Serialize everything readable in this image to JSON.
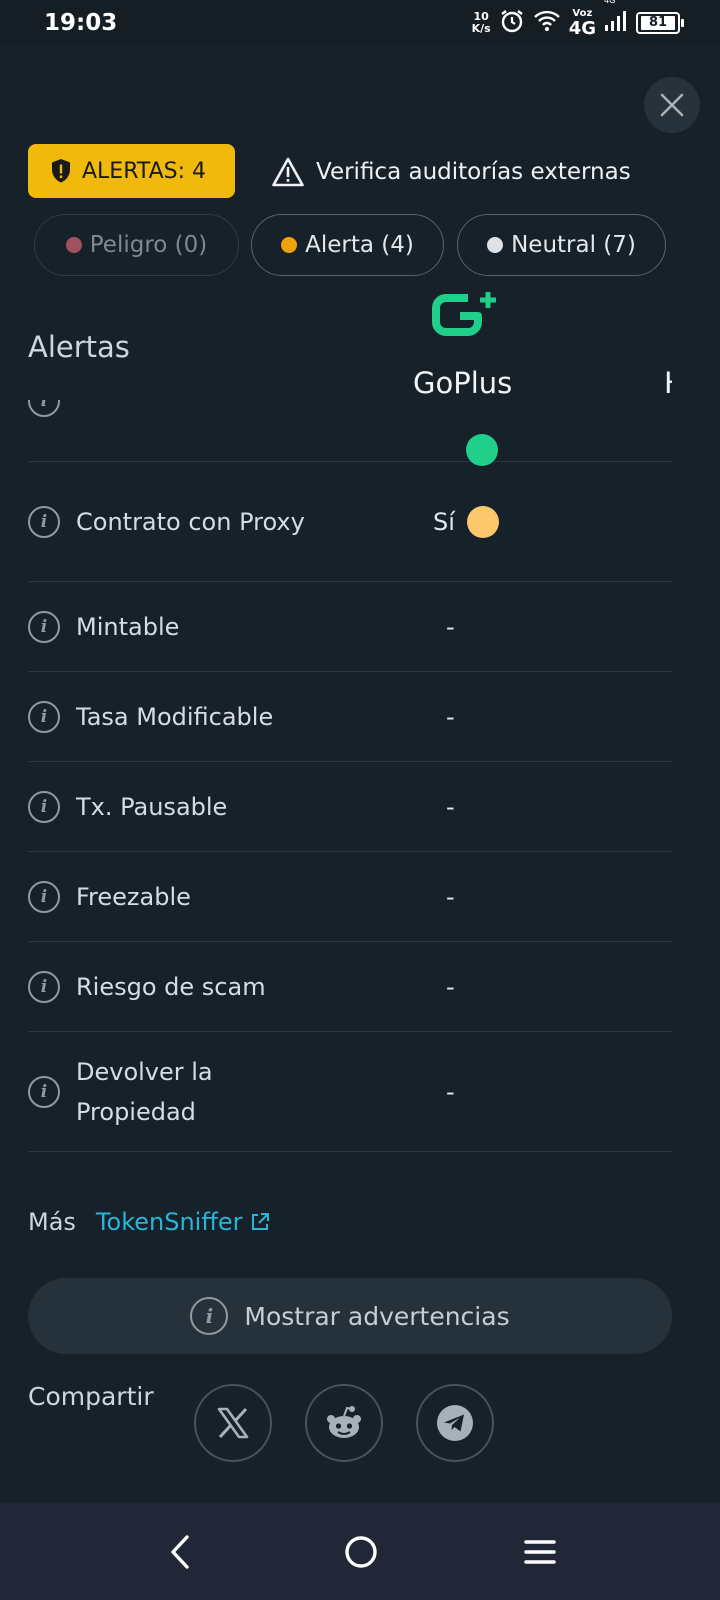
{
  "status_bar": {
    "time": "19:03",
    "net_speed_value": "10",
    "net_speed_unit": "K/s",
    "voz_label": "Voz",
    "network": "4G",
    "signal_label": "4G",
    "battery": "81"
  },
  "header": {
    "alert_badge": "ALERTAS: 4",
    "audit_text": "Verifica auditorías externas"
  },
  "filters": [
    {
      "label": "Peligro (0)",
      "color": "#b85a69"
    },
    {
      "label": "Alerta (4)",
      "color": "#f0a20b"
    },
    {
      "label": "Neutral (7)",
      "color": "#dde2e6"
    }
  ],
  "table": {
    "column_title": "Alertas",
    "provider_name": "GoPlus",
    "next_provider_partial": "H",
    "rows": [
      {
        "label": "Contrato con Proxy",
        "value": "Sí"
      },
      {
        "label": "Mintable",
        "value": "-"
      },
      {
        "label": "Tasa Modificable",
        "value": "-"
      },
      {
        "label": "Tx. Pausable",
        "value": "-"
      },
      {
        "label": "Freezable",
        "value": "-"
      },
      {
        "label": "Riesgo de scam",
        "value": "-"
      },
      {
        "label": "Devolver la Propiedad",
        "value": "-"
      }
    ]
  },
  "footer": {
    "more_label": "Más",
    "more_link": "TokenSniffer",
    "show_warnings": "Mostrar advertencias",
    "share_label": "Compartir"
  },
  "colors": {
    "background": "#17212a",
    "accent_yellow": "#f0b90b",
    "link": "#2bb4d8",
    "goplus_green": "#1fcf8a"
  }
}
